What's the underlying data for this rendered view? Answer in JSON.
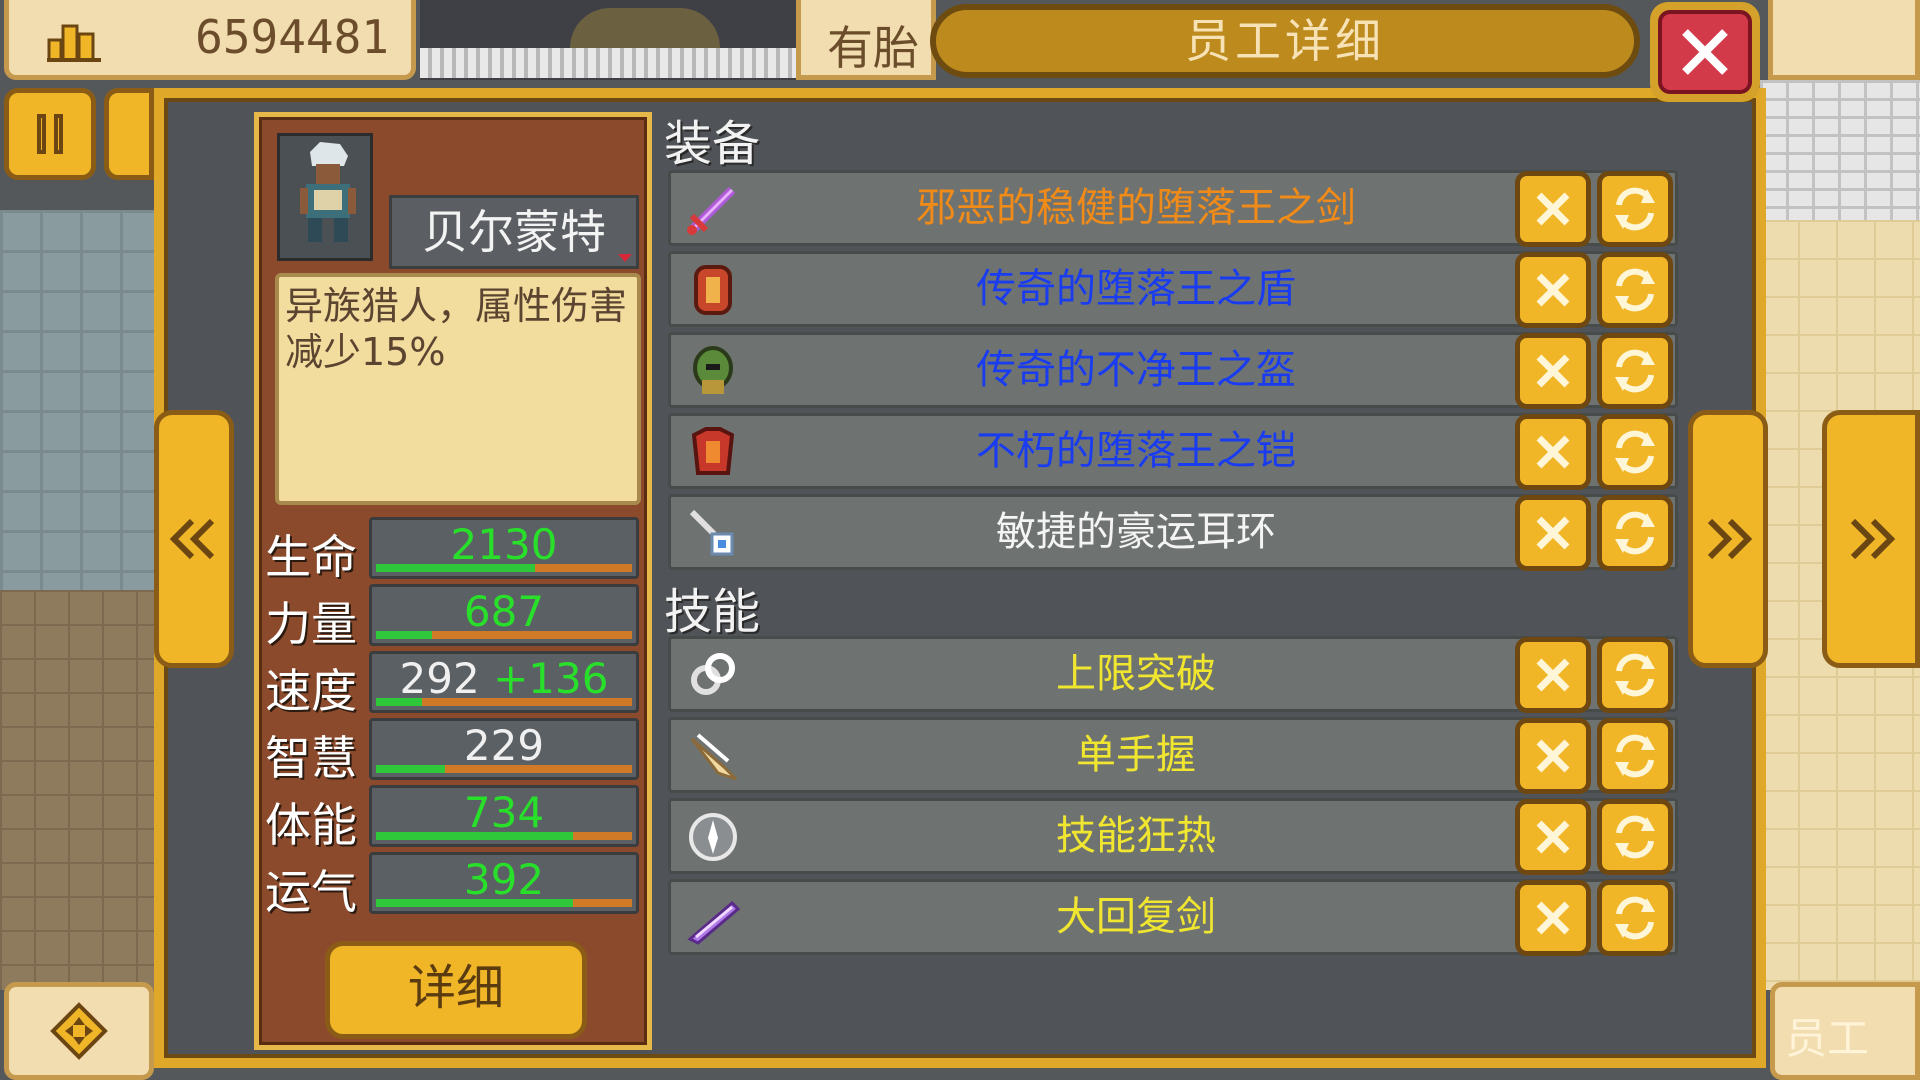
{
  "hud": {
    "gold_value": "6594481",
    "top_middle_label": "有胎",
    "bottom_right_label": "员工"
  },
  "dialog": {
    "title": "员工详细"
  },
  "character": {
    "name": "贝尔蒙特",
    "description": "异族猎人，属性伤害减少15%",
    "stats": [
      {
        "label": "生命",
        "value": "2130",
        "bonus": "",
        "fill": 0.62,
        "value_color": "green"
      },
      {
        "label": "力量",
        "value": "687",
        "bonus": "",
        "fill": 0.22,
        "value_color": "green"
      },
      {
        "label": "速度",
        "value": "292",
        "bonus": "+136",
        "fill": 0.18,
        "value_color": "white"
      },
      {
        "label": "智慧",
        "value": "229",
        "bonus": "",
        "fill": 0.27,
        "value_color": "white"
      },
      {
        "label": "体能",
        "value": "734",
        "bonus": "",
        "fill": 0.77,
        "value_color": "green"
      },
      {
        "label": "运气",
        "value": "392",
        "bonus": "",
        "fill": 0.77,
        "value_color": "green"
      }
    ],
    "detail_button": "详细"
  },
  "equipment": {
    "label": "装备",
    "items": [
      {
        "name": "邪恶的稳健的堕落王之剑",
        "quality": "orange",
        "icon": "sword-icon"
      },
      {
        "name": "传奇的堕落王之盾",
        "quality": "blue",
        "icon": "shield-icon"
      },
      {
        "name": "传奇的不净王之盔",
        "quality": "blue",
        "icon": "helmet-icon"
      },
      {
        "name": "不朽的堕落王之铠",
        "quality": "blue",
        "icon": "armor-icon"
      },
      {
        "name": "敏捷的豪运耳环",
        "quality": "white",
        "icon": "earring-icon"
      }
    ]
  },
  "skills": {
    "label": "技能",
    "items": [
      {
        "name": "上限突破",
        "icon": "chain-icon"
      },
      {
        "name": "单手握",
        "icon": "claw-icon"
      },
      {
        "name": "技能狂热",
        "icon": "flame-orb-icon"
      },
      {
        "name": "大回复剑",
        "icon": "crystal-blade-icon"
      }
    ]
  },
  "colors": {
    "gold_frame": "#e0a828",
    "panel_bg": "#505458",
    "card_bg": "#8b4a2b",
    "quality_orange": "#f08a18",
    "quality_blue": "#1a3cf0",
    "skill_yellow": "#f0e630",
    "stat_green": "#28e02a"
  }
}
